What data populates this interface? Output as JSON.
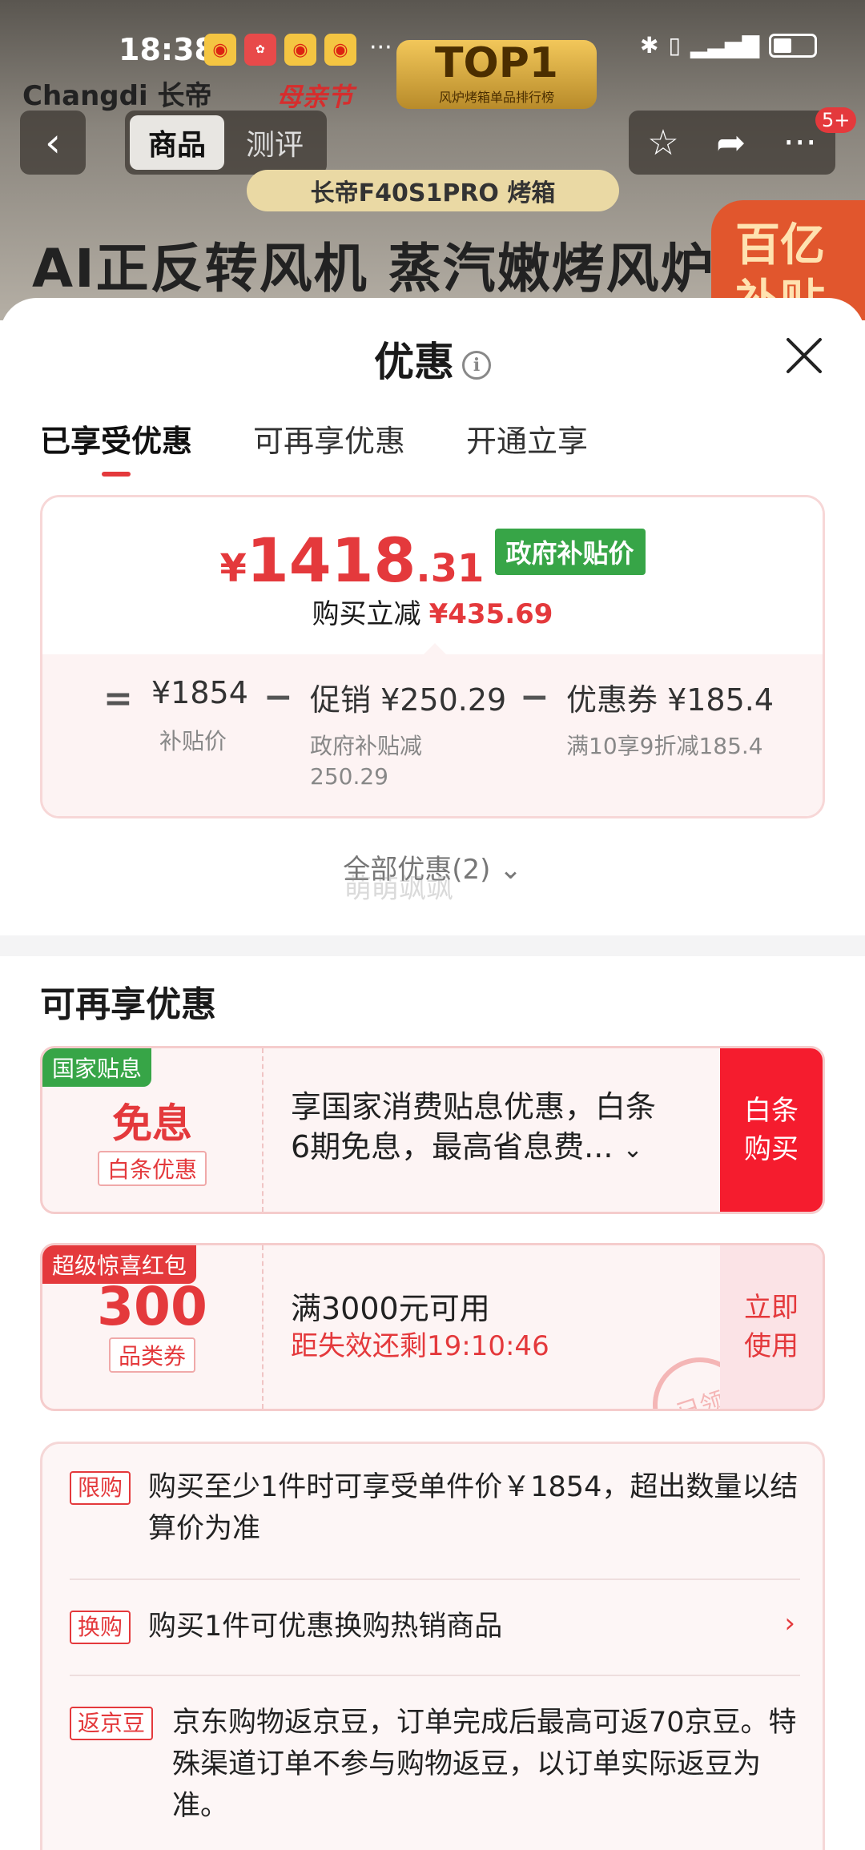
{
  "status_bar": {
    "time": "18:38",
    "dots": "···"
  },
  "hero": {
    "brand": "Changdi 长帝",
    "festival": "母亲节",
    "rank_big": "TOP1",
    "rank_small": "风炉烤箱单品排行榜",
    "product_name": "长帝F40S1PRO 烤箱",
    "slogan": "AI正反转风机 蒸汽嫩烤风炉",
    "corner_tag": "百亿补贴"
  },
  "nav": {
    "back": "‹",
    "tabs": [
      "商品",
      "测评"
    ],
    "badge": "5+"
  },
  "sheet": {
    "title": "优惠",
    "tabs": [
      "已享受优惠",
      "可再享优惠",
      "开通立享"
    ],
    "price": {
      "yen": "¥",
      "integer": "1418",
      "decimal": ".31",
      "badge": "政府补贴价"
    },
    "reduce": {
      "label": "购买立减",
      "amount": "¥435.69"
    },
    "breakdown": {
      "eq": "=",
      "base": "¥1854",
      "base_label": "补贴价",
      "minus1": "−",
      "promo": "促销 ¥250.29",
      "promo_sub1": "政府补贴减",
      "promo_sub2": "250.29",
      "minus2": "−",
      "coupon": "优惠券 ¥185.4",
      "coupon_sub": "满10享9折减185.4"
    },
    "all_offers": "全部优惠(2)",
    "watermark": "萌萌飒飒"
  },
  "more": {
    "title": "可再享优惠",
    "card1": {
      "tag": "国家贴息",
      "big": "免息",
      "small": "白条优惠",
      "line1": "享国家消费贴息优惠，白条",
      "line2": "6期免息，最高省息费...",
      "action1": "白条",
      "action2": "购买"
    },
    "card2": {
      "tag": "超级惊喜红包",
      "big": "300",
      "small": "品类券",
      "line1": "满3000元可用",
      "line2": "距失效还剩19:10:46",
      "action1": "立即",
      "action2": "使用",
      "stamp": "已领"
    }
  },
  "rules": [
    {
      "tag": "限购",
      "text": "购买至少1件时可享受单件价￥1854，超出数量以结算价为准"
    },
    {
      "tag": "换购",
      "text": "购买1件可优惠换购热销商品"
    },
    {
      "tag": "返京豆",
      "text": "京东购物返京豆，订单完成后最高可返70京豆。特殊渠道订单不参与购物返豆，以订单实际返豆为准。"
    }
  ],
  "colors": {
    "accent": "#e4393c",
    "green_badge": "#37a547"
  }
}
